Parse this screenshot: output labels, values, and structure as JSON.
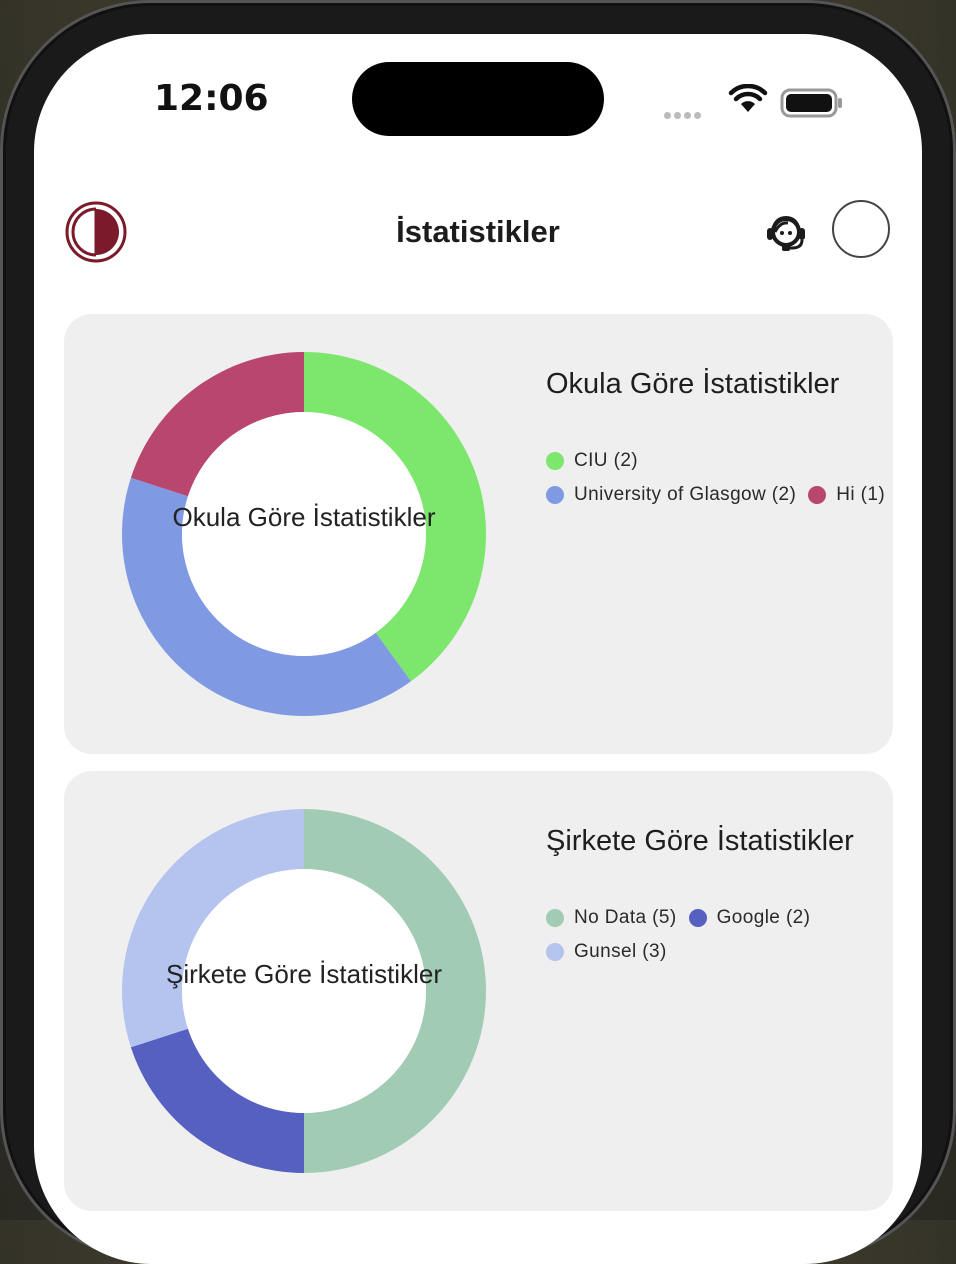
{
  "status_bar": {
    "time": "12:06"
  },
  "header": {
    "title": "İstatistikler"
  },
  "icons": {
    "logo": "logo-icon",
    "support": "headset-icon",
    "avatar": "avatar"
  },
  "colors": {
    "logo_red": "#7a1a2a",
    "card_background": "#efefef"
  },
  "chart_data": [
    {
      "type": "pie",
      "title": "Okula Göre İstatistikler",
      "center_label": "Okula Göre İstatistikler",
      "categories": [
        "CIU",
        "University of Glasgow",
        "Hi"
      ],
      "values": [
        2,
        2,
        1
      ],
      "colors": [
        "#7de66d",
        "#7f9ae3",
        "#b8466f"
      ],
      "legend": [
        "CIU (2)",
        "University of Glasgow (2)",
        "Hi (1)"
      ]
    },
    {
      "type": "pie",
      "title": "Şirkete Göre İstatistikler",
      "center_label": "Şirkete Göre İstatistikler",
      "categories": [
        "No Data",
        "Google",
        "Gunsel"
      ],
      "values": [
        5,
        2,
        3
      ],
      "colors": [
        "#a2cbb3",
        "#5660c1",
        "#b4c4ee"
      ],
      "legend": [
        "No Data (5)",
        "Google (2)",
        "Gunsel (3)"
      ]
    }
  ]
}
